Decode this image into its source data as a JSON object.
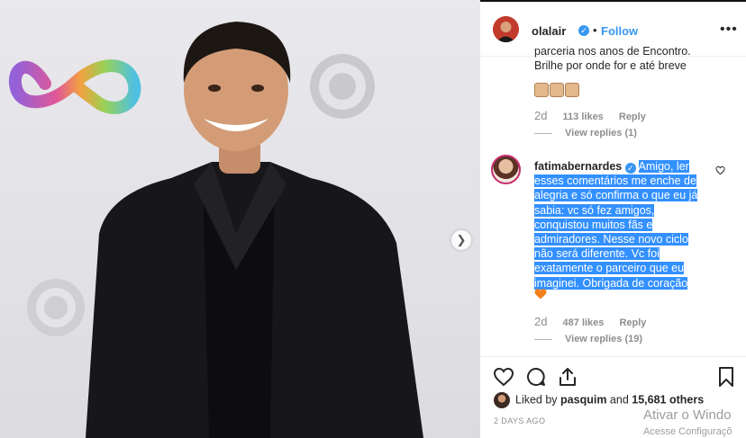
{
  "post": {
    "photo_alt": "",
    "next_icon": "chevron-right-icon",
    "header": {
      "username": "olalair",
      "separator": "•",
      "follow_label": "Follow",
      "more_label": "•••"
    },
    "comments": [
      {
        "text_lines": [
          "parceria nos anos de Encontro.",
          "Brilhe por onde for e até breve"
        ],
        "emoji": "clapping-hands",
        "time": "2d",
        "likes": "113 likes",
        "reply_label": "Reply",
        "view_replies": "View replies (1)"
      },
      {
        "username": "fatimabernardes",
        "text": "Amigo, ler esses comentários me enche de alegria e só confirma o que eu já sabia: vc só fez amigos, conquistou muitos fãs e admiradores. Nesse novo ciclo não será diferente. Vc foi exatamente o parceiro que eu imaginei. Obrigada de coração",
        "time": "2d",
        "likes": "487 likes",
        "reply_label": "Reply",
        "view_replies": "View replies (19)"
      }
    ],
    "liked_by": {
      "prefix": "Liked by ",
      "user": "pasquim",
      "middle": " and ",
      "count": "15,681 others"
    },
    "posted": "2 DAYS AGO"
  },
  "watermark": {
    "line1": "Ativar o Windo",
    "line2": "Acesse Configuraçõ"
  },
  "colors": {
    "accent": "#3897f0",
    "selection": "#3390ff",
    "text": "#262626",
    "muted": "#8e8e8e"
  }
}
